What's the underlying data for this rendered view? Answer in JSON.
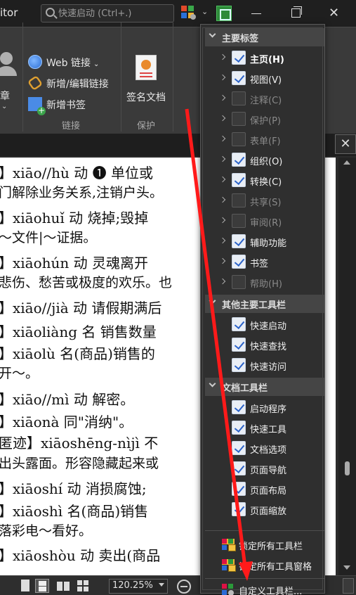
{
  "app": {
    "title_fragment": "itor"
  },
  "search": {
    "placeholder": "快速启动 (Ctrl+.)"
  },
  "ribbon": {
    "left_label": "章",
    "web_link": "Web 链接",
    "add_edit_link": "新增/编辑链接",
    "add_bookmark": "新增书签",
    "group_link": "链接",
    "sign_document": "签名文档",
    "group_protect": "保护"
  },
  "page_lines": [
    "】xiāo//hù 动 ❶ 单位或",
    "门解除业务关系,注销户头。",
    "】xiāohuǐ 动 烧掉;毁掉",
    "～文件|～证据。",
    "】xiāohún 动 灵魂离开",
    "悲伤、愁苦或极度的欢乐。也",
    "】xiāo//jià 动 请假期满后",
    "】xiāoliàng 名 销售数量",
    "】xiāolù 名(商品)销售的",
    "开～。",
    "】xiāo//mì 动 解密。",
    "】xiāonà 同\"消纳\"。",
    "匿迹】xiāoshēng-nìjì 不",
    "出头露面。形容隐藏起来或",
    "】xiāoshí 动 消损腐蚀;",
    "】xiāoshì 名(商品)销售",
    "落彩电～看好。",
    "】xiāoshòu 动 卖出(商品"
  ],
  "status": {
    "zoom": "120.25%"
  },
  "menu": {
    "sections": [
      {
        "title": "主要标签",
        "items": [
          {
            "label": "主页(H)",
            "checked": true,
            "enabled": true,
            "bold": true
          },
          {
            "label": "视图(V)",
            "checked": true,
            "enabled": true
          },
          {
            "label": "注释(C)",
            "checked": false,
            "enabled": false
          },
          {
            "label": "保护(P)",
            "checked": false,
            "enabled": false
          },
          {
            "label": "表单(F)",
            "checked": false,
            "enabled": false
          },
          {
            "label": "组织(O)",
            "checked": true,
            "enabled": true
          },
          {
            "label": "转换(C)",
            "checked": true,
            "enabled": true
          },
          {
            "label": "共享(S)",
            "checked": false,
            "enabled": false
          },
          {
            "label": "审阅(R)",
            "checked": false,
            "enabled": false
          },
          {
            "label": "辅助功能",
            "checked": true,
            "enabled": true
          },
          {
            "label": "书签",
            "checked": true,
            "enabled": true
          },
          {
            "label": "帮助(H)",
            "checked": false,
            "enabled": false
          }
        ]
      },
      {
        "title": "其他主要工具栏",
        "items": [
          {
            "label": "快速启动",
            "checked": true,
            "enabled": true
          },
          {
            "label": "快速查找",
            "checked": true,
            "enabled": true
          },
          {
            "label": "快速访问",
            "checked": true,
            "enabled": true
          }
        ]
      },
      {
        "title": "文档工具栏",
        "items": [
          {
            "label": "启动程序",
            "checked": true,
            "enabled": true
          },
          {
            "label": "快速工具",
            "checked": true,
            "enabled": true
          },
          {
            "label": "文档选项",
            "checked": true,
            "enabled": true
          },
          {
            "label": "页面导航",
            "checked": true,
            "enabled": true
          },
          {
            "label": "页面布局",
            "checked": true,
            "enabled": true
          },
          {
            "label": "页面缩放",
            "checked": true,
            "enabled": true
          }
        ]
      }
    ],
    "actions": {
      "lock_toolbars": "锁定所有工具栏",
      "lock_panes": "锁定所有工具窗格",
      "customize": "自定义工具栏..."
    }
  },
  "colors": {
    "annotation_arrow": "#ff1a1a",
    "check_blue": "#2b63c9"
  }
}
